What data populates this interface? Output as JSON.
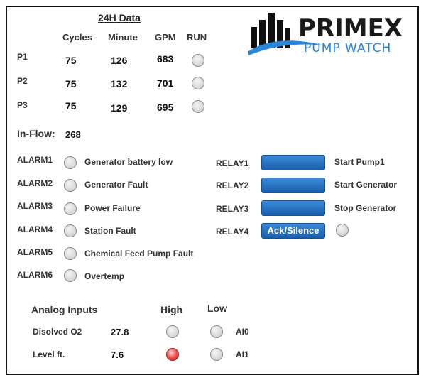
{
  "header": {
    "title": "24H Data",
    "columns": [
      "Cycles",
      "Minute",
      "GPM",
      "RUN"
    ]
  },
  "logo": {
    "brand": "PRIMEX",
    "subtitle": "PUMP WATCH"
  },
  "pumps": [
    {
      "label": "P1",
      "cycles": "75",
      "minute": "126",
      "gpm": "683",
      "run": false
    },
    {
      "label": "P2",
      "cycles": "75",
      "minute": "132",
      "gpm": "701",
      "run": false
    },
    {
      "label": "P3",
      "cycles": "75",
      "minute": "129",
      "gpm": "695",
      "run": false
    }
  ],
  "inflow": {
    "label": "In-Flow:",
    "value": "268"
  },
  "alarms": [
    {
      "label": "ALARM1",
      "text": "Generator battery low",
      "active": false
    },
    {
      "label": "ALARM2",
      "text": "Generator Fault",
      "active": false
    },
    {
      "label": "ALARM3",
      "text": "Power Failure",
      "active": false
    },
    {
      "label": "ALARM4",
      "text": "Station Fault",
      "active": false
    },
    {
      "label": "ALARM5",
      "text": "Chemical Feed Pump Fault",
      "active": false
    },
    {
      "label": "ALARM6",
      "text": "Overtemp",
      "active": false
    }
  ],
  "relays": [
    {
      "label": "RELAY1",
      "button": "",
      "action": "Start Pump1"
    },
    {
      "label": "RELAY2",
      "button": "",
      "action": "Start Generator"
    },
    {
      "label": "RELAY3",
      "button": "",
      "action": "Stop Generator"
    },
    {
      "label": "RELAY4",
      "button": "Ack/Silence",
      "action": "",
      "indicator": false
    }
  ],
  "analog": {
    "title": "Analog Inputs",
    "high_label": "High",
    "low_label": "Low",
    "rows": [
      {
        "name": "Disolved O2",
        "value": "27.8",
        "high": false,
        "low": false,
        "channel": "AI0"
      },
      {
        "name": "Level ft.",
        "value": "7.6",
        "high": true,
        "low": false,
        "channel": "AI1"
      }
    ]
  },
  "colors": {
    "button_blue": "#1a5fae",
    "logo_blue": "#2a86d6",
    "alarm_red": "#e03030"
  }
}
